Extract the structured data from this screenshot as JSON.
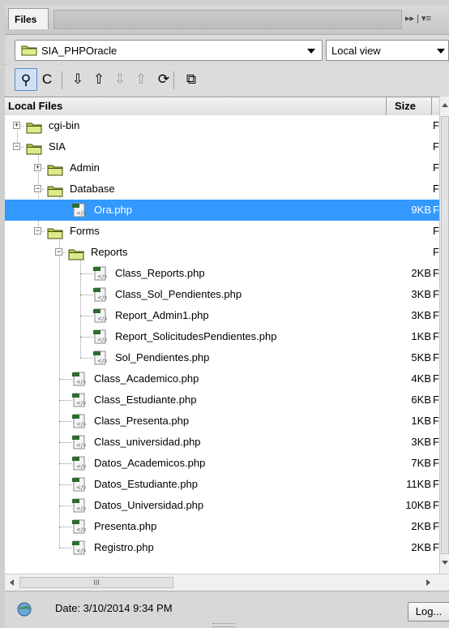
{
  "panel": {
    "tab_label": "Files",
    "panel_menu": "▸▸ | ▾≡"
  },
  "site_selector": {
    "value": "SIA_PHPOracle"
  },
  "view_selector": {
    "value": "Local view"
  },
  "toolbar": {
    "buttons": [
      {
        "name": "connect-icon",
        "glyph": "⚲",
        "state": "pressed"
      },
      {
        "name": "refresh-icon",
        "glyph": "C",
        "state": "normal"
      },
      {
        "name": "get-files-icon",
        "glyph": "⇩",
        "state": "normal"
      },
      {
        "name": "put-files-icon",
        "glyph": "⇧",
        "state": "normal"
      },
      {
        "name": "check-out-icon",
        "glyph": "⇩",
        "state": "disabled"
      },
      {
        "name": "check-in-icon",
        "glyph": "⇧",
        "state": "disabled"
      },
      {
        "name": "synchronize-icon",
        "glyph": "⟳",
        "state": "normal"
      },
      {
        "name": "expand-panel-icon",
        "glyph": "⧉",
        "state": "normal"
      }
    ]
  },
  "columns": {
    "local_files": "Local Files",
    "size": "Size"
  },
  "tree": [
    {
      "label": "cgi-bin",
      "type": "folder",
      "level": 0,
      "expander": "+",
      "size": "",
      "extra": "F"
    },
    {
      "label": "SIA",
      "type": "folder",
      "level": 0,
      "expander": "-",
      "size": "",
      "extra": "F"
    },
    {
      "label": "Admin",
      "type": "folder",
      "level": 1,
      "expander": "+",
      "size": "",
      "extra": "F"
    },
    {
      "label": "Database",
      "type": "folder",
      "level": 1,
      "expander": "-",
      "size": "",
      "extra": "F"
    },
    {
      "label": "Ora.php",
      "type": "php",
      "level": 2,
      "expander": "",
      "size": "9KB",
      "extra": "F",
      "selected": true
    },
    {
      "label": "Forms",
      "type": "folder",
      "level": 1,
      "expander": "-",
      "size": "",
      "extra": "F"
    },
    {
      "label": "Reports",
      "type": "folder",
      "level": 2,
      "expander": "-",
      "size": "",
      "extra": "F"
    },
    {
      "label": "Class_Reports.php",
      "type": "php",
      "level": 3,
      "expander": "",
      "size": "2KB",
      "extra": "F"
    },
    {
      "label": "Class_Sol_Pendientes.php",
      "type": "php",
      "level": 3,
      "expander": "",
      "size": "3KB",
      "extra": "F"
    },
    {
      "label": "Report_Admin1.php",
      "type": "php",
      "level": 3,
      "expander": "",
      "size": "3KB",
      "extra": "F"
    },
    {
      "label": "Report_SolicitudesPendientes.php",
      "type": "php",
      "level": 3,
      "expander": "",
      "size": "1KB",
      "extra": "F"
    },
    {
      "label": "Sol_Pendientes.php",
      "type": "php",
      "level": 3,
      "expander": "",
      "size": "5KB",
      "extra": "F"
    },
    {
      "label": "Class_Academico.php",
      "type": "php",
      "level": 2,
      "expander": "",
      "size": "4KB",
      "extra": "F"
    },
    {
      "label": "Class_Estudiante.php",
      "type": "php",
      "level": 2,
      "expander": "",
      "size": "6KB",
      "extra": "F"
    },
    {
      "label": "Class_Presenta.php",
      "type": "php",
      "level": 2,
      "expander": "",
      "size": "1KB",
      "extra": "F"
    },
    {
      "label": "Class_universidad.php",
      "type": "php",
      "level": 2,
      "expander": "",
      "size": "3KB",
      "extra": "F"
    },
    {
      "label": "Datos_Academicos.php",
      "type": "php",
      "level": 2,
      "expander": "",
      "size": "7KB",
      "extra": "F"
    },
    {
      "label": "Datos_Estudiante.php",
      "type": "php",
      "level": 2,
      "expander": "",
      "size": "11KB",
      "extra": "F"
    },
    {
      "label": "Datos_Universidad.php",
      "type": "php",
      "level": 2,
      "expander": "",
      "size": "10KB",
      "extra": "F"
    },
    {
      "label": "Presenta.php",
      "type": "php",
      "level": 2,
      "expander": "",
      "size": "2KB",
      "extra": "F"
    },
    {
      "label": "Registro.php",
      "type": "php",
      "level": 2,
      "expander": "",
      "size": "2KB",
      "extra": "F"
    }
  ],
  "hscroll": {
    "thumb_glyph": "III"
  },
  "status": {
    "date": "Date: 3/10/2014 9:34 PM",
    "log_button": "Log..."
  },
  "colors": {
    "selection": "#3399ff",
    "folder": "#c8d65a",
    "php_green": "#2e6b2e"
  }
}
